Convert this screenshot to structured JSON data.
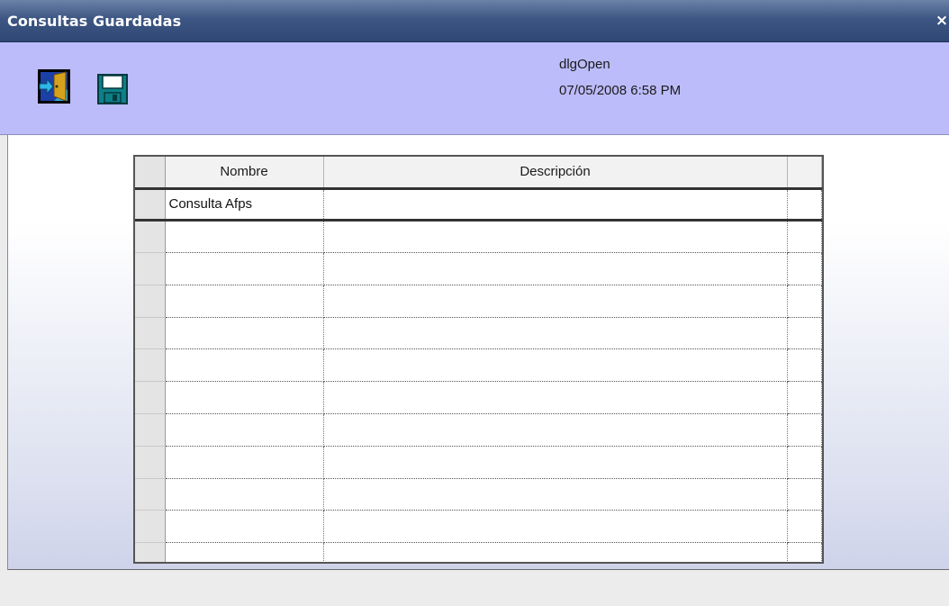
{
  "window": {
    "title": "Consultas Guardadas",
    "close_label": "×"
  },
  "toolbar": {
    "buttons": [
      {
        "name": "exit-button",
        "icon": "exit-door-icon"
      },
      {
        "name": "save-button",
        "icon": "floppy-disk-icon"
      }
    ],
    "info_name": "dlgOpen",
    "info_datetime": "07/05/2008 6:58 PM",
    "background": "#bcbcfb"
  },
  "table": {
    "columns": [
      "Nombre",
      "Descripción"
    ],
    "rows": [
      {
        "nombre": "Consulta Afps",
        "descripcion": ""
      },
      {
        "nombre": "",
        "descripcion": ""
      },
      {
        "nombre": "",
        "descripcion": ""
      },
      {
        "nombre": "",
        "descripcion": ""
      },
      {
        "nombre": "",
        "descripcion": ""
      },
      {
        "nombre": "",
        "descripcion": ""
      },
      {
        "nombre": "",
        "descripcion": ""
      },
      {
        "nombre": "",
        "descripcion": ""
      },
      {
        "nombre": "",
        "descripcion": ""
      },
      {
        "nombre": "",
        "descripcion": ""
      },
      {
        "nombre": "",
        "descripcion": ""
      },
      {
        "nombre": "",
        "descripcion": ""
      }
    ]
  }
}
